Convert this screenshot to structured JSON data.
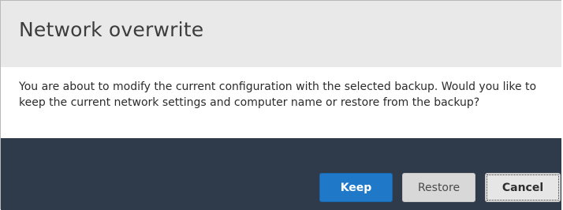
{
  "dialog": {
    "title": "Network overwrite",
    "message": "You are about to modify the current configuration with the selected backup. Would you like to keep the current network settings and computer name or restore from the backup?",
    "buttons": {
      "keep": "Keep",
      "restore": "Restore",
      "cancel": "Cancel"
    }
  },
  "colors": {
    "header_bg": "#e9e9e9",
    "footer_bg": "#2f3b4a",
    "primary_button": "#1f79c8",
    "secondary_button": "#d8d8d8"
  }
}
